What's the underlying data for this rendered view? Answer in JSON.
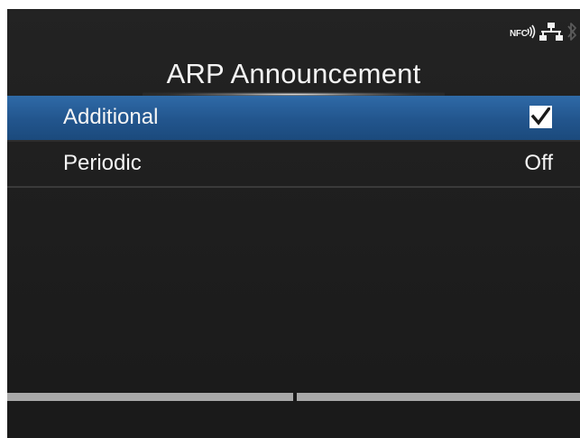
{
  "status_bar": {
    "nfc_label": "NFC",
    "icons": [
      "nfc-icon",
      "network-icon",
      "bluetooth-icon"
    ]
  },
  "header": {
    "title": "ARP Announcement"
  },
  "menu": {
    "items": [
      {
        "label": "Additional",
        "value_type": "checkbox",
        "checked": true,
        "selected": true
      },
      {
        "label": "Periodic",
        "value": "Off",
        "value_type": "text",
        "selected": false
      }
    ]
  },
  "colors": {
    "background": "#1f1f1f",
    "selection": "#22558d",
    "text": "#f5f5f5",
    "footer_bar": "#a9a9a9"
  },
  "footer": {
    "left_label": "",
    "right_label": ""
  }
}
